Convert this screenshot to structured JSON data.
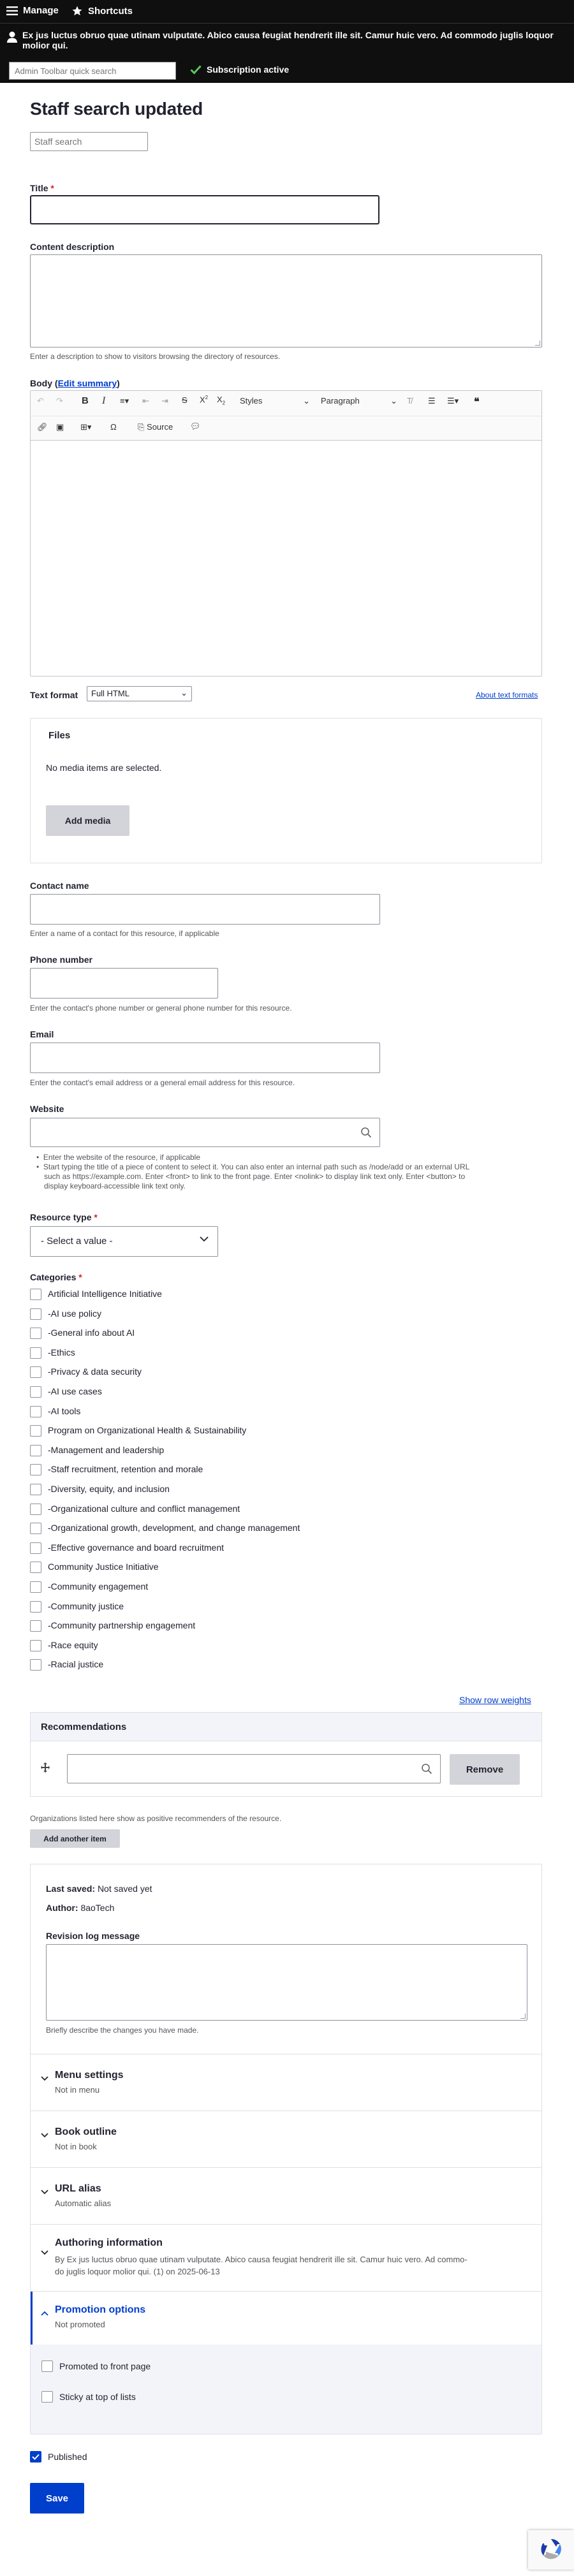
{
  "toolbar": {
    "manage_label": "Manage",
    "shortcuts_label": "Shortcuts",
    "message_line1": "Ex jus luctus obruo quae utinam vulputate. Abico causa feugiat hendrerit ille sit. Camur huic vero. Ad commodo juglis loquor",
    "message_line2": "molior qui.",
    "search_placeholder": "Admin Toolbar quick search",
    "subscription_label": "Subscription active"
  },
  "page": {
    "title": "Staff search updated",
    "staff_search_placeholder": "Staff search"
  },
  "fields": {
    "title_label": "Title",
    "required_mark": "*",
    "content_description_label": "Content description",
    "content_description_help": "Enter a description to show to visitors browsing the directory of resources.",
    "body_label": "Body (",
    "body_edit_summary": "Edit summary",
    "body_label_end": ")",
    "editor_styles": "Styles",
    "editor_paragraph": "Paragraph",
    "editor_source": "Source",
    "text_format_label": "Text format",
    "text_format_value": "Full HTML",
    "about_text_formats": "About text formats",
    "files_legend": "Files",
    "files_empty": "No media items are selected.",
    "add_media_button": "Add media",
    "contact_name_label": "Contact name",
    "contact_name_help": "Enter a name of a contact for this resource, if applicable",
    "phone_label": "Phone number",
    "phone_help": "Enter the contact's phone number or general phone number for this resource.",
    "email_label": "Email",
    "email_help": "Enter the contact's email address or a general email address for this resource.",
    "website_label": "Website",
    "website_help_1": "Enter the website of the resource, if applicable",
    "website_help_2a": "Start typing the title of a piece of content to select it. You can also enter an internal path such as /node/add or an external URL",
    "website_help_2b": "such as https://example.com. Enter <front> to link to the front page. Enter <nolink> to display link text only. Enter <button> to",
    "website_help_2c": "display keyboard-accessible link text only.",
    "resource_type_label": "Resource type",
    "resource_type_value": "- Select a value -",
    "categories_label": "Categories"
  },
  "categories": [
    {
      "label": "Artificial Intelligence Initiative"
    },
    {
      "label": "-AI use policy"
    },
    {
      "label": "-General info about AI"
    },
    {
      "label": "-Ethics"
    },
    {
      "label": "-Privacy & data security"
    },
    {
      "label": "-AI use cases"
    },
    {
      "label": "-AI tools"
    },
    {
      "label": "Program on Organizational Health & Sustainability"
    },
    {
      "label": "-Management and leadership"
    },
    {
      "label": "-Staff recruitment, retention and morale"
    },
    {
      "label": "-Diversity, equity, and inclusion"
    },
    {
      "label": "-Organizational culture and conflict management"
    },
    {
      "label": "-Organizational growth, development, and change management"
    },
    {
      "label": "-Effective governance and board recruitment"
    },
    {
      "label": "Community Justice Initiative"
    },
    {
      "label": "-Community engagement"
    },
    {
      "label": "-Community justice"
    },
    {
      "label": "-Community partnership engagement"
    },
    {
      "label": "-Race equity"
    },
    {
      "label": "-Racial justice"
    }
  ],
  "recommendations": {
    "show_row_weights": "Show row weights",
    "header": "Recommendations",
    "remove_button": "Remove",
    "help": "Organizations listed here show as positive recommenders of the resource.",
    "add_another_button": "Add another item"
  },
  "sidebar": {
    "last_saved_label": "Last saved:",
    "last_saved_value": "Not saved yet",
    "author_label": "Author:",
    "author_value": "8aoTech",
    "revision_label": "Revision log message",
    "revision_help": "Briefly describe the changes you have made.",
    "menu_title": "Menu settings",
    "menu_sub": "Not in menu",
    "book_title": "Book outline",
    "book_sub": "Not in book",
    "url_title": "URL alias",
    "url_sub": "Automatic alias",
    "authoring_title": "Authoring information",
    "authoring_sub_1": "By Ex jus luctus obruo quae utinam vulputate. Abico causa feugiat hendrerit ille sit. Camur huic vero. Ad commo-",
    "authoring_sub_2": "do juglis loquor molior qui. (1) on 2025-06-13",
    "promotion_title": "Promotion options",
    "promotion_sub": "Not promoted",
    "promoted_label": "Promoted to front page",
    "sticky_label": "Sticky at top of lists"
  },
  "footer": {
    "published_label": "Published",
    "save_button": "Save"
  },
  "colors": {
    "accent": "#003ecc",
    "toolbar": "#0f0f0f",
    "required": "#dc2323",
    "checkmark": "#5ac85a"
  }
}
